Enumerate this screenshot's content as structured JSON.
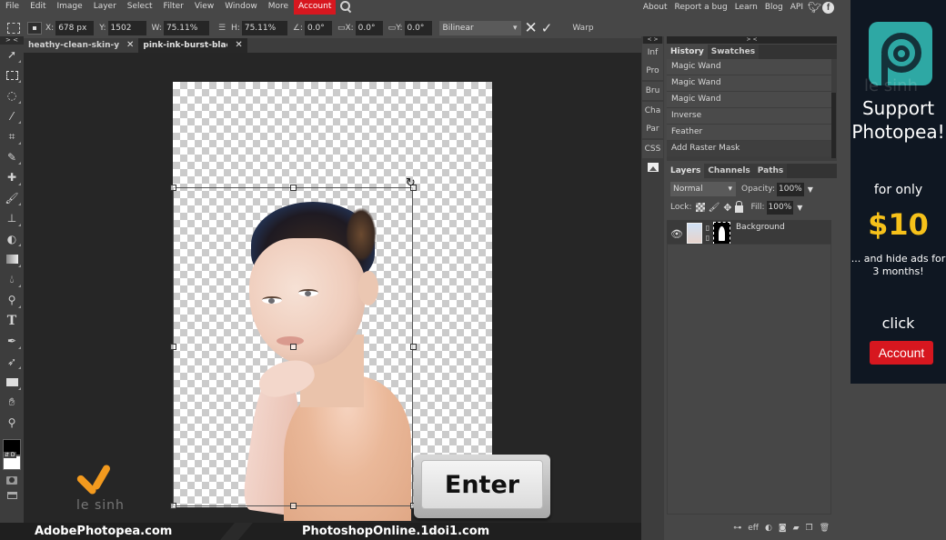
{
  "menubar": {
    "items": [
      "File",
      "Edit",
      "Image",
      "Layer",
      "Select",
      "Filter",
      "View",
      "Window",
      "More"
    ],
    "account_label": "Account",
    "right_links": [
      "About",
      "Report a bug",
      "Learn",
      "Blog",
      "API"
    ],
    "social": [
      "twitter-icon",
      "facebook-icon"
    ]
  },
  "options": {
    "x_label": "X:",
    "x_value": "678 px",
    "y_label": "Y:",
    "y_value": "1502 px",
    "w_label": "W:",
    "w_value": "75.11%",
    "h_label": "H:",
    "h_value": "75.11%",
    "angle_label": "∠:",
    "angle_value": "0.0°",
    "skew_x_label": "X:",
    "skew_x_value": "0.0°",
    "skew_y_label": "Y:",
    "skew_y_value": "0.0°",
    "interpolation": "Bilinear",
    "cancel_glyph": "✕",
    "commit_glyph": "✓",
    "warp_label": "Warp"
  },
  "tabs": [
    {
      "name": "heathy-clean-skin-young-woman",
      "close": "✕",
      "active": false
    },
    {
      "name": "pink-ink-burst-black",
      "close": "✕",
      "active": true
    }
  ],
  "tools": {
    "collapse": "> <",
    "items": [
      "move",
      "marquee",
      "lasso",
      "magic-wand",
      "crop",
      "eyedropper",
      "healing-brush",
      "brush",
      "clone-stamp",
      "eraser",
      "gradient",
      "blur",
      "dodge",
      "type",
      "pen",
      "path-select",
      "rectangle",
      "hand",
      "zoom"
    ],
    "swap_label": "⇵ D"
  },
  "mini_panel": {
    "header": "< >",
    "buttons": [
      "Inf",
      "Pro",
      "Bru",
      "Cha",
      "Par",
      "CSS"
    ]
  },
  "history_panel": {
    "header": "> <",
    "tabs": [
      "History",
      "Swatches"
    ],
    "items": [
      "Magic Wand",
      "Magic Wand",
      "Magic Wand",
      "Inverse",
      "Feather",
      "Add Raster Mask"
    ]
  },
  "layers_panel": {
    "tabs": [
      "Layers",
      "Channels",
      "Paths"
    ],
    "blend_mode": "Normal",
    "opacity_label": "Opacity:",
    "opacity_value": "100%",
    "lock_label": "Lock:",
    "fill_label": "Fill:",
    "fill_value": "100%",
    "layers": [
      {
        "name": "Background",
        "visible": true,
        "has_mask": true
      }
    ],
    "footer_icons": [
      "link-layers-icon",
      "effects-icon",
      "adjustment-icon",
      "mask-icon",
      "folder-icon",
      "new-layer-icon",
      "delete-icon"
    ],
    "footer_fx": "eff"
  },
  "overlay": {
    "enter_key": "Enter",
    "logo_text": "le sinh",
    "banner_left": "AdobePhotopea.com",
    "banner_right": "PhotoshopOnline.1doi1.com"
  },
  "ad": {
    "watermark": "le sinh",
    "title": "Support Photopea!",
    "for_only": "for only",
    "price": "$10",
    "subtitle": "... and hide ads for 3 months!",
    "click": "click",
    "button": "Account",
    "accent": "#d7171f",
    "price_color": "#f6c11a",
    "logo_color": "#2ea8a4"
  }
}
